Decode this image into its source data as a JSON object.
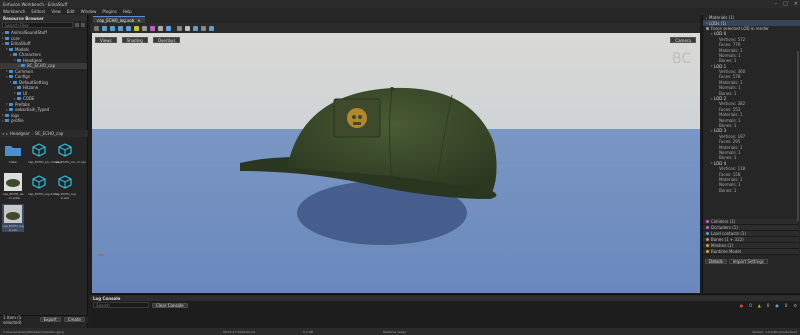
{
  "app": {
    "title": "Enfusion Workbench - ErikaStuff"
  },
  "menu": [
    "Workbench",
    "Editors",
    "View",
    "Edit",
    "Window",
    "Plugins",
    "Help",
    "Help"
  ],
  "resource_browser": {
    "title": "Resource Browser",
    "search_placeholder": "Search Files",
    "tree": [
      {
        "label": "AnimalSoundStuff",
        "depth": 0
      },
      {
        "label": "core",
        "depth": 0
      },
      {
        "label": "ErikaStuff",
        "depth": 0
      },
      {
        "label": "Models",
        "depth": 1
      },
      {
        "label": "Characters",
        "depth": 2
      },
      {
        "label": "Headgear",
        "depth": 3
      },
      {
        "label": "BC_ECHO_cap",
        "depth": 4,
        "selected": true
      },
      {
        "label": "Common",
        "depth": 1
      },
      {
        "label": "Configs",
        "depth": 1
      },
      {
        "label": "DefaultSetting",
        "depth": 2
      },
      {
        "label": "Hitzone",
        "depth": 3
      },
      {
        "label": "UI",
        "depth": 3
      },
      {
        "label": "CODE",
        "depth": 3
      },
      {
        "label": "Prefabs",
        "depth": 1
      },
      {
        "label": "sebastiaih_Typed",
        "depth": 1
      },
      {
        "label": "logs",
        "depth": 0
      },
      {
        "label": "profile",
        "depth": 0
      }
    ],
    "breadcrumb": [
      "Headgear",
      "BC_ECHO_cap"
    ],
    "files": [
      {
        "name": "Data",
        "icon": "folder-icon"
      },
      {
        "name": "cap_ECHO_sh...m.xlsx",
        "icon": "cube-icon"
      },
      {
        "name": "cap_ECHO_sh...m.xei",
        "icon": "cube-icon"
      },
      {
        "name": "cap_ECHO_de ...m.edds",
        "icon": "texture-icon"
      },
      {
        "name": "cap_ECHO_log.2.fbx",
        "icon": "cube-icon"
      },
      {
        "name": "cap_ECHO_log 2.xob",
        "icon": "cube-icon"
      },
      {
        "name": "cap_ECHO_log 0.xob",
        "icon": "cap-icon",
        "selected": true
      }
    ],
    "footer_count": "1 Item (1 selected)",
    "export_label": "Export",
    "create_label": "Create"
  },
  "editor": {
    "tab_label": "cap_ECHO_log.xob",
    "view_buttons": [
      "Views",
      "Shading",
      "Overlays"
    ],
    "camera_button": "Camera",
    "watermark": "BC"
  },
  "properties": {
    "header_rows": [
      "Materials (1)",
      "LODs (1)"
    ],
    "checkbox_label": "Force selected LOD in render",
    "lods": [
      {
        "name": "LOD 0",
        "vertices": "Vertices: 572",
        "faces": "Faces: 779",
        "materials": "Materials: 1",
        "normals": "Normals: 1",
        "bones": "Bones: 1"
      },
      {
        "name": "LOD 1",
        "vertices": "Vertices: 360",
        "faces": "Faces: 578",
        "materials": "Materials: 1",
        "normals": "Normals: 1",
        "bones": "Bones: 1"
      },
      {
        "name": "LOD 2",
        "vertices": "Vertices: 382",
        "faces": "Faces: 553",
        "materials": "Materials: 1",
        "normals": "Normals: 1",
        "bones": "Bones: 1"
      },
      {
        "name": "LOD 3",
        "vertices": "Vertices: 187",
        "faces": "Faces: 295",
        "materials": "Materials: 1",
        "normals": "Normals: 1",
        "bones": "Bones: 1"
      },
      {
        "name": "LOD 4",
        "vertices": "Vertices: 118",
        "faces": "Faces: 158",
        "materials": "Materials: 1",
        "normals": "Normals: 1",
        "bones": "Bones: 1"
      }
    ],
    "sections": [
      {
        "label": "Colliders (1)",
        "color": "#d05ad0"
      },
      {
        "label": "Occluders (1)",
        "color": "#d05ad0"
      },
      {
        "label": "Land contacts (1)",
        "color": "#5a9fd0"
      },
      {
        "label": "Bones (1 + 322)",
        "color": "#9a9a9a"
      },
      {
        "label": "Meshes (1)",
        "color": "#e0a030"
      },
      {
        "label": "Runtime Model",
        "color": "#e0a030"
      }
    ],
    "bottom_tabs": [
      "Details",
      "Import Settings"
    ]
  },
  "console": {
    "title": "Log Console",
    "search_placeholder": "Search",
    "clear_label": "Clear Console",
    "counts": {
      "errors": "0",
      "warnings": "0",
      "info": "0"
    }
  },
  "status": {
    "path": "C:/Users/Library/Workbench/Addon.gproj",
    "time": "09:15:17 2024-02-14",
    "mem": "6.2 GB",
    "status_text": "Realtime ready",
    "version": "Version: 1.0.0.80 (production)"
  }
}
